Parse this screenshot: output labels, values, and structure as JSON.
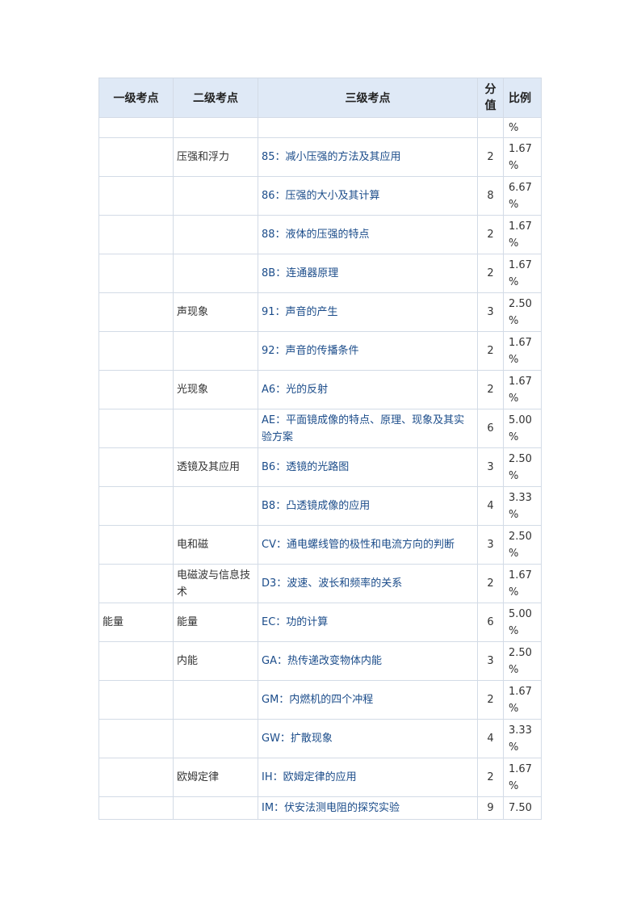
{
  "headers": {
    "level1": "一级考点",
    "level2": "二级考点",
    "level3": "三级考点",
    "score": "分值",
    "ratio": "比例"
  },
  "top_fragment": {
    "ratio": "%"
  },
  "rows": [
    {
      "level1": "",
      "level2": "压强和浮力",
      "level3": "85：减小压强的方法及其应用",
      "score": "2",
      "ratio": "1.67 %"
    },
    {
      "level1": "",
      "level2": "",
      "level3": "86：压强的大小及其计算",
      "score": "8",
      "ratio": "6.67 %"
    },
    {
      "level1": "",
      "level2": "",
      "level3": "88：液体的压强的特点",
      "score": "2",
      "ratio": "1.67 %"
    },
    {
      "level1": "",
      "level2": "",
      "level3": "8B：连通器原理",
      "score": "2",
      "ratio": "1.67 %"
    },
    {
      "level1": "",
      "level2": "声现象",
      "level3": "91：声音的产生",
      "score": "3",
      "ratio": "2.50 %"
    },
    {
      "level1": "",
      "level2": "",
      "level3": "92：声音的传播条件",
      "score": "2",
      "ratio": "1.67 %"
    },
    {
      "level1": "",
      "level2": "光现象",
      "level3": "A6：光的反射",
      "score": "2",
      "ratio": "1.67 %"
    },
    {
      "level1": "",
      "level2": "",
      "level3": "AE：平面镜成像的特点、原理、现象及其实验方案",
      "score": "6",
      "ratio": "5.00 %"
    },
    {
      "level1": "",
      "level2": "透镜及其应用",
      "level3": "B6：透镜的光路图",
      "score": "3",
      "ratio": "2.50 %"
    },
    {
      "level1": "",
      "level2": "",
      "level3": "B8：凸透镜成像的应用",
      "score": "4",
      "ratio": "3.33 %"
    },
    {
      "level1": "",
      "level2": "电和磁",
      "level3": "CV：通电螺线管的极性和电流方向的判断",
      "score": "3",
      "ratio": "2.50 %"
    },
    {
      "level1": "",
      "level2": "电磁波与信息技术",
      "level3": "D3：波速、波长和频率的关系",
      "score": "2",
      "ratio": "1.67 %"
    },
    {
      "level1": "能量",
      "level2": "能量",
      "level3": "EC：功的计算",
      "score": "6",
      "ratio": "5.00 %"
    },
    {
      "level1": "",
      "level2": "内能",
      "level3": "GA：热传递改变物体内能",
      "score": "3",
      "ratio": "2.50 %"
    },
    {
      "level1": "",
      "level2": "",
      "level3": "GM：内燃机的四个冲程",
      "score": "2",
      "ratio": "1.67 %"
    },
    {
      "level1": "",
      "level2": "",
      "level3": "GW：扩散现象",
      "score": "4",
      "ratio": "3.33 %"
    },
    {
      "level1": "",
      "level2": "欧姆定律",
      "level3": "IH：欧姆定律的应用",
      "score": "2",
      "ratio": "1.67 %"
    }
  ],
  "bottom_fragment": {
    "level3": "IM：伏安法测电阻的探究实验",
    "score": "9",
    "ratio": "7.50"
  }
}
